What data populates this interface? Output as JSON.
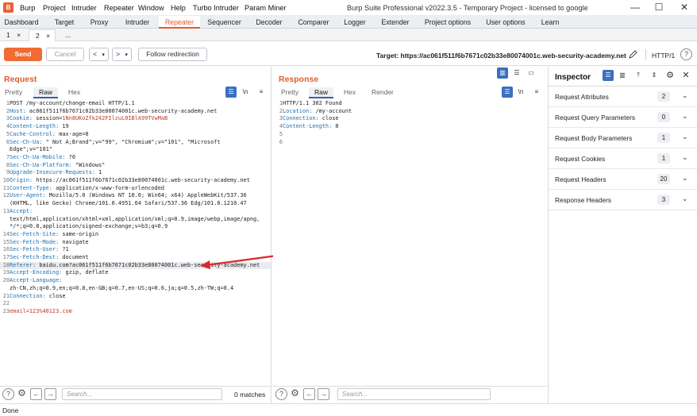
{
  "app": {
    "logo": "B",
    "menu": [
      "Burp",
      "Project",
      "Intruder",
      "Repeater",
      "Window",
      "Help",
      "Turbo Intruder",
      "Param Miner"
    ],
    "window_title": "Burp Suite Professional v2022.3.5 - Temporary Project - licensed to google"
  },
  "main_tabs": [
    "Dashboard",
    "Target",
    "Proxy",
    "Intruder",
    "Repeater",
    "Sequencer",
    "Decoder",
    "Comparer",
    "Logger",
    "Extender",
    "Project options",
    "User options",
    "Learn"
  ],
  "main_tab_active": "Repeater",
  "repeater_tabs": [
    {
      "label": "1",
      "close": "×"
    },
    {
      "label": "2",
      "close": "×"
    },
    {
      "label": "..."
    }
  ],
  "toolbar": {
    "send": "Send",
    "cancel": "Cancel",
    "back": "<",
    "back_menu": "▾",
    "forward": ">",
    "forward_menu": "▾",
    "follow_redirection": "Follow redirection",
    "target": "Target: https://ac061f511f6b7671c02b33e80074001c.web-security-academy.net",
    "http_version": "HTTP/1"
  },
  "request": {
    "title": "Request",
    "tabs": [
      "Pretty",
      "Raw",
      "Hex"
    ],
    "active_tab": "Raw",
    "newline_toggle": "\\n",
    "lines": [
      {
        "n": "1",
        "text": "POST /my-account/change-email HTTP/1.1"
      },
      {
        "n": "2",
        "key": "Host:",
        "val": " ac061f511f6b7671c02b33e80074001c.web-security-academy.net"
      },
      {
        "n": "3",
        "key": "Cookie:",
        "val": " session=",
        "red": "1Nn8UKoZfk242FIlzuL0IBlA99TVwMaB"
      },
      {
        "n": "4",
        "key": "Content-Length:",
        "val": " 19"
      },
      {
        "n": "5",
        "key": "Cache-Control:",
        "val": " max-age=0"
      },
      {
        "n": "6",
        "key": "Sec-Ch-Ua:",
        "val": " \" Not A;Brand\";v=\"99\", \"Chromium\";v=\"101\", \"Microsoft"
      },
      {
        "n": "",
        "text": "Edge\";v=\"101\""
      },
      {
        "n": "7",
        "key": "Sec-Ch-Ua-Mobile:",
        "val": " ?0"
      },
      {
        "n": "8",
        "key": "Sec-Ch-Ua-Platform:",
        "val": " \"Windows\""
      },
      {
        "n": "9",
        "key": "Upgrade-Insecure-Requests:",
        "val": " 1"
      },
      {
        "n": "10",
        "key": "Origin:",
        "val": " https://ac061f511f6b7671c02b33e80074001c.web-security-academy.net"
      },
      {
        "n": "11",
        "key": "Content-Type:",
        "val": " application/x-www-form-urlencoded"
      },
      {
        "n": "12",
        "key": "User-Agent:",
        "val": " Mozilla/5.0 (Windows NT 10.0; Win64; x64) AppleWebKit/537.36"
      },
      {
        "n": "",
        "text": "(KHTML, like Gecko) Chrome/101.0.4951.64 Safari/537.36 Edg/101.0.1210.47"
      },
      {
        "n": "13",
        "key": "Accept:",
        "val": ""
      },
      {
        "n": "",
        "text": "text/html,application/xhtml+xml,application/xml;q=0.9,image/webp,image/apng,"
      },
      {
        "n": "",
        "text": "*/*;q=0.8,application/signed-exchange;v=b3;q=0.9"
      },
      {
        "n": "14",
        "key": "Sec-Fetch-Site:",
        "val": " same-origin"
      },
      {
        "n": "15",
        "key": "Sec-Fetch-Mode:",
        "val": " navigate"
      },
      {
        "n": "16",
        "key": "Sec-Fetch-User:",
        "val": " ?1"
      },
      {
        "n": "17",
        "key": "Sec-Fetch-Dest:",
        "val": " document"
      },
      {
        "n": "18",
        "key": "Referer:",
        "val": " baidu.com?ac061f511f6b7671c02b33e80074001c.web-security-academy.net",
        "hl": true
      },
      {
        "n": "19",
        "key": "Accept-Encoding:",
        "val": " gzip, deflate"
      },
      {
        "n": "20",
        "key": "Accept-Language:",
        "val": ""
      },
      {
        "n": "",
        "text": "zh-CN,zh;q=0.9,en;q=0.8,en-GB;q=0.7,en-US;q=0.6,ja;q=0.5,zh-TW;q=0.4"
      },
      {
        "n": "21",
        "key": "Connection:",
        "val": " close"
      },
      {
        "n": "22",
        "text": ""
      },
      {
        "n": "23",
        "red": "email=123%40123.com"
      }
    ],
    "search_placeholder": "Search...",
    "matches": "0 matches"
  },
  "response": {
    "title": "Response",
    "tabs": [
      "Pretty",
      "Raw",
      "Hex",
      "Render"
    ],
    "active_tab": "Raw",
    "newline_toggle": "\\n",
    "lines": [
      {
        "n": "1",
        "text": "HTTP/1.1 302 Found"
      },
      {
        "n": "2",
        "key": "Location:",
        "val": " /my-account"
      },
      {
        "n": "3",
        "key": "Connection:",
        "val": " close"
      },
      {
        "n": "4",
        "key": "Content-Length:",
        "val": " 0"
      },
      {
        "n": "5",
        "text": ""
      },
      {
        "n": "6",
        "text": ""
      }
    ],
    "search_placeholder": "Search..."
  },
  "inspector": {
    "title": "Inspector",
    "rows": [
      {
        "label": "Request Attributes",
        "count": "2"
      },
      {
        "label": "Request Query Parameters",
        "count": "0"
      },
      {
        "label": "Request Body Parameters",
        "count": "1"
      },
      {
        "label": "Request Cookies",
        "count": "1"
      },
      {
        "label": "Request Headers",
        "count": "20"
      },
      {
        "label": "Response Headers",
        "count": "3"
      }
    ]
  },
  "status": "Done",
  "colors": {
    "accent": "#e25c2d",
    "send": "#ef6c33",
    "header_key": "#1a6fb4",
    "cookie_value": "#c0392b",
    "arrow": "#d9262a"
  }
}
